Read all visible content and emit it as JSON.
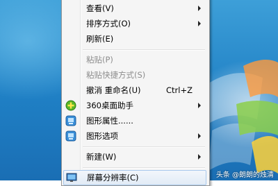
{
  "menu": {
    "items": [
      {
        "label": "查看(V)"
      },
      {
        "label": "排序方式(O)"
      },
      {
        "label": "刷新(E)"
      },
      {
        "label": "粘贴(P)"
      },
      {
        "label": "粘贴快捷方式(S)"
      },
      {
        "label": "撤消 重命名(U)",
        "shortcut": "Ctrl+Z"
      },
      {
        "label": "360桌面助手",
        "icon": "360-assistant-icon"
      },
      {
        "label": "图形属性......",
        "icon": "graphics-properties-icon"
      },
      {
        "label": "图形选项",
        "icon": "graphics-options-icon"
      },
      {
        "label": "新建(W)"
      },
      {
        "label": "屏幕分辨率(C)",
        "icon": "screen-resolution-icon"
      }
    ]
  },
  "watermark": "头条 @朗朗的烛清",
  "colors": {
    "desktop_blue": "#1f7fc4",
    "menu_bg": "#f5f5f5",
    "hover_border": "#a8c8ec",
    "disabled_text": "#8d8d8d"
  }
}
